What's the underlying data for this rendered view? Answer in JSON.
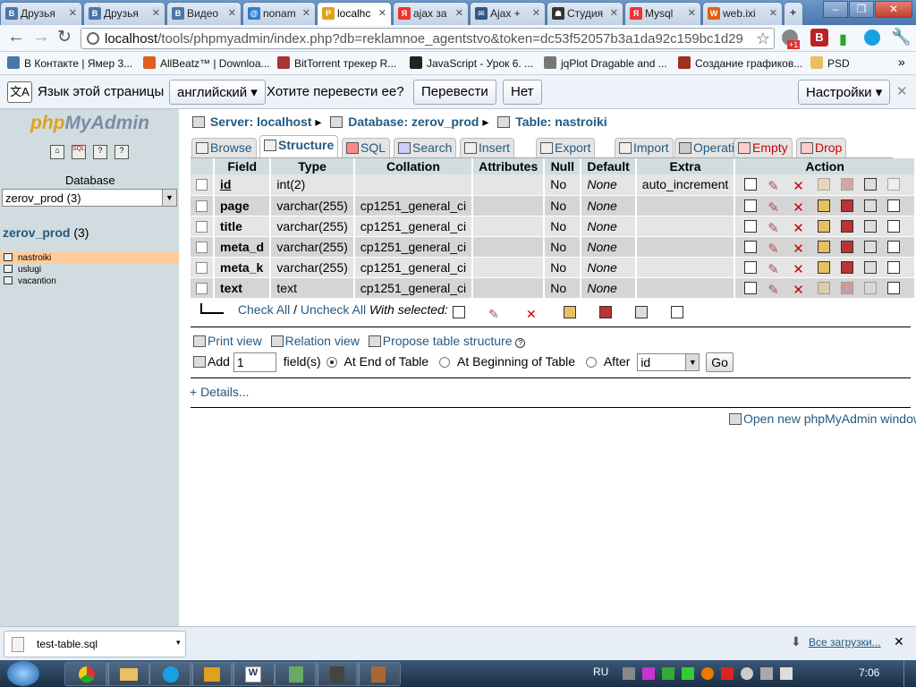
{
  "browser": {
    "tabs": [
      {
        "label": "Друзья",
        "fav": "vk-icon",
        "color": "#4a76a8",
        "glyph": "B"
      },
      {
        "label": "Друзья",
        "fav": "vk-icon",
        "color": "#4a76a8",
        "glyph": "B"
      },
      {
        "label": "Видео",
        "fav": "vk-icon",
        "color": "#4a76a8",
        "glyph": "B"
      },
      {
        "label": "nonam",
        "fav": "globe-icon",
        "color": "#2a7fd0",
        "glyph": "@"
      },
      {
        "label": "localhc",
        "fav": "pma-icon",
        "color": "#e0a020",
        "glyph": "P"
      },
      {
        "label": "ajax за",
        "fav": "yandex-icon",
        "color": "#e33",
        "glyph": "Я"
      },
      {
        "label": "Ajax +",
        "fav": "mail-icon",
        "color": "#335588",
        "glyph": "✉"
      },
      {
        "label": "Студия",
        "fav": "spy-icon",
        "color": "#333",
        "glyph": "☗"
      },
      {
        "label": "Mysql",
        "fav": "yandex-icon",
        "color": "#e33",
        "glyph": "Я"
      },
      {
        "label": "web.ixi",
        "fav": "w-icon",
        "color": "#e06010",
        "glyph": "W"
      }
    ],
    "url_host": "localhost",
    "url_rest": "/tools/phpmyadmin/index.php?db=reklamnoe_agentstvo&token=dc53f52057b3a1da92c159bc1d29",
    "bookmarks": [
      {
        "label": "В Контакте | Ямер 3...",
        "color": "#4a76a8"
      },
      {
        "label": "AllBeatz™ | Downloa...",
        "color": "#e06020"
      },
      {
        "label": "BitTorrent трекер R...",
        "color": "#aa3333"
      },
      {
        "label": "JavaScript - Урок 6. ...",
        "color": "#222"
      },
      {
        "label": "jqPlot Dragable and ...",
        "color": "#777"
      },
      {
        "label": "Создание графиков...",
        "color": "#a03020"
      },
      {
        "label": "PSD",
        "color": "#e8c060"
      }
    ],
    "translate": {
      "page_lang_label": "Язык этой страницы",
      "lang_value": "английский",
      "question": "Хотите перевести ее?",
      "translate_btn": "Перевести",
      "no_btn": "Нет",
      "settings_btn": "Настройки"
    }
  },
  "sidebar": {
    "logo_php": "php",
    "logo_my": "MyAdmin",
    "db_label": "Database",
    "db_select": "zerov_prod (3)",
    "db_name": "zerov_prod",
    "db_count": "(3)",
    "tables": [
      "nastroiki",
      "uslugi",
      "vacantion"
    ]
  },
  "breadcrumb": {
    "server": "Server: localhost",
    "database": "Database: zerov_prod",
    "table": "Table: nastroiki"
  },
  "tabs": [
    "Browse",
    "Structure",
    "SQL",
    "Search",
    "Insert",
    "Export",
    "Import",
    "Operations",
    "Empty",
    "Drop"
  ],
  "columns": [
    "Field",
    "Type",
    "Collation",
    "Attributes",
    "Null",
    "Default",
    "Extra",
    "Action"
  ],
  "rows": [
    {
      "field": "id",
      "type": "int(2)",
      "collation": "",
      "attributes": "",
      "null": "No",
      "default": "None",
      "extra": "auto_increment"
    },
    {
      "field": "page",
      "type": "varchar(255)",
      "collation": "cp1251_general_ci",
      "attributes": "",
      "null": "No",
      "default": "None",
      "extra": ""
    },
    {
      "field": "title",
      "type": "varchar(255)",
      "collation": "cp1251_general_ci",
      "attributes": "",
      "null": "No",
      "default": "None",
      "extra": ""
    },
    {
      "field": "meta_d",
      "type": "varchar(255)",
      "collation": "cp1251_general_ci",
      "attributes": "",
      "null": "No",
      "default": "None",
      "extra": ""
    },
    {
      "field": "meta_k",
      "type": "varchar(255)",
      "collation": "cp1251_general_ci",
      "attributes": "",
      "null": "No",
      "default": "None",
      "extra": ""
    },
    {
      "field": "text",
      "type": "text",
      "collation": "cp1251_general_ci",
      "attributes": "",
      "null": "No",
      "default": "None",
      "extra": ""
    }
  ],
  "with_selected": {
    "check_all": "Check All",
    "uncheck_all": "Uncheck All",
    "label": "With selected:"
  },
  "actions": {
    "print_view": "Print view",
    "relation_view": "Relation view",
    "propose": "Propose table structure",
    "add": "Add",
    "add_count": "1",
    "fields_label": "field(s)",
    "at_end": "At End of Table",
    "at_begin": "At Beginning of Table",
    "after": "After",
    "after_value": "id",
    "go": "Go",
    "details": "+ Details...",
    "open_new": "Open new phpMyAdmin window"
  },
  "download": {
    "file": "test-table.sql",
    "all_downloads": "Все загрузки..."
  },
  "taskbar": {
    "lang": "RU",
    "time": "7:06"
  }
}
